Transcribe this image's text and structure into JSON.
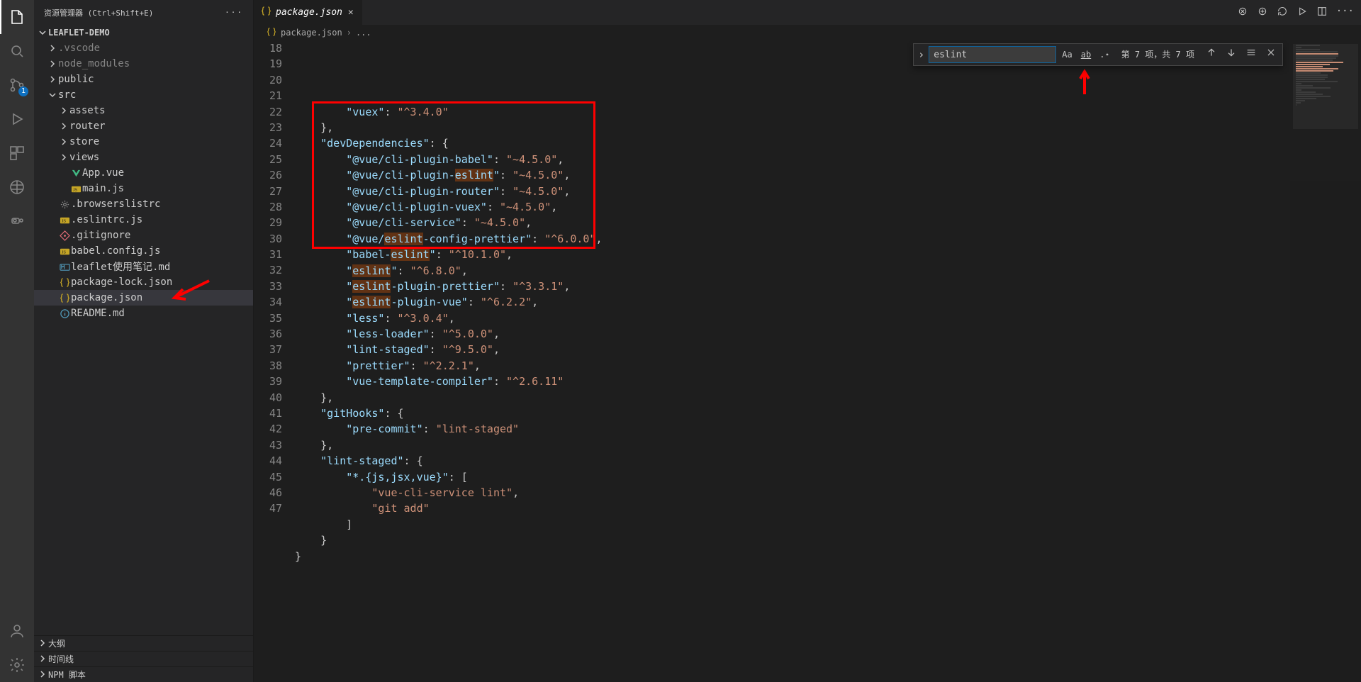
{
  "sidebar": {
    "title": "资源管理器 (Ctrl+Shift+E)",
    "project": "LEAFLET-DEMO",
    "outline": "大纲",
    "timeline": "时间线",
    "npm": "NPM 脚本",
    "sourceControlBadge": "1"
  },
  "tree": [
    {
      "depth": 1,
      "kind": "folder",
      "open": false,
      "label": ".vscode",
      "dim": true
    },
    {
      "depth": 1,
      "kind": "folder",
      "open": false,
      "label": "node_modules",
      "dim": true
    },
    {
      "depth": 1,
      "kind": "folder",
      "open": false,
      "label": "public"
    },
    {
      "depth": 1,
      "kind": "folder",
      "open": true,
      "label": "src"
    },
    {
      "depth": 2,
      "kind": "folder",
      "open": false,
      "label": "assets"
    },
    {
      "depth": 2,
      "kind": "folder",
      "open": false,
      "label": "router"
    },
    {
      "depth": 2,
      "kind": "folder",
      "open": false,
      "label": "store"
    },
    {
      "depth": 2,
      "kind": "folder",
      "open": false,
      "label": "views"
    },
    {
      "depth": 2,
      "kind": "file",
      "icon": "vue",
      "label": "App.vue"
    },
    {
      "depth": 2,
      "kind": "file",
      "icon": "js",
      "label": "main.js"
    },
    {
      "depth": 1,
      "kind": "file",
      "icon": "gear",
      "label": ".browserslistrc"
    },
    {
      "depth": 1,
      "kind": "file",
      "icon": "js",
      "label": ".eslintrc.js"
    },
    {
      "depth": 1,
      "kind": "file",
      "icon": "git",
      "label": ".gitignore"
    },
    {
      "depth": 1,
      "kind": "file",
      "icon": "js",
      "label": "babel.config.js"
    },
    {
      "depth": 1,
      "kind": "file",
      "icon": "md",
      "label": "leaflet使用笔记.md"
    },
    {
      "depth": 1,
      "kind": "file",
      "icon": "json",
      "label": "package-lock.json"
    },
    {
      "depth": 1,
      "kind": "file",
      "icon": "json",
      "label": "package.json",
      "selected": true
    },
    {
      "depth": 1,
      "kind": "file",
      "icon": "info",
      "label": "README.md"
    }
  ],
  "tab": {
    "label": "package.json"
  },
  "crumbs": {
    "file": "package.json",
    "tail": "..."
  },
  "find": {
    "value": "eslint",
    "count": "第 7 项，共 7 项"
  },
  "code": {
    "startLine": 18,
    "highlightWord": "eslint",
    "lines": [
      [
        [
          "        ",
          ""
        ],
        [
          "\"vuex\"",
          "k"
        ],
        [
          ": ",
          ""
        ],
        [
          "\"^3.4.0\"",
          "s"
        ]
      ],
      [
        [
          "    },",
          ""
        ]
      ],
      [
        [
          "    ",
          ""
        ],
        [
          "\"devDependencies\"",
          "k"
        ],
        [
          ": {",
          ""
        ]
      ],
      [
        [
          "        ",
          ""
        ],
        [
          "\"@vue/cli-plugin-babel\"",
          "k"
        ],
        [
          ": ",
          ""
        ],
        [
          "\"~4.5.0\"",
          "s"
        ],
        [
          ",",
          ""
        ]
      ],
      [
        [
          "        ",
          ""
        ],
        [
          "\"@vue/cli-plugin-eslint\"",
          "k"
        ],
        [
          ": ",
          ""
        ],
        [
          "\"~4.5.0\"",
          "s"
        ],
        [
          ",",
          ""
        ]
      ],
      [
        [
          "        ",
          ""
        ],
        [
          "\"@vue/cli-plugin-router\"",
          "k"
        ],
        [
          ": ",
          ""
        ],
        [
          "\"~4.5.0\"",
          "s"
        ],
        [
          ",",
          ""
        ]
      ],
      [
        [
          "        ",
          ""
        ],
        [
          "\"@vue/cli-plugin-vuex\"",
          "k"
        ],
        [
          ": ",
          ""
        ],
        [
          "\"~4.5.0\"",
          "s"
        ],
        [
          ",",
          ""
        ]
      ],
      [
        [
          "        ",
          ""
        ],
        [
          "\"@vue/cli-service\"",
          "k"
        ],
        [
          ": ",
          ""
        ],
        [
          "\"~4.5.0\"",
          "s"
        ],
        [
          ",",
          ""
        ]
      ],
      [
        [
          "        ",
          ""
        ],
        [
          "\"@vue/eslint-config-prettier\"",
          "k"
        ],
        [
          ": ",
          ""
        ],
        [
          "\"^6.0.0\"",
          "s"
        ],
        [
          ",",
          ""
        ]
      ],
      [
        [
          "        ",
          ""
        ],
        [
          "\"babel-eslint\"",
          "k"
        ],
        [
          ": ",
          ""
        ],
        [
          "\"^10.1.0\"",
          "s"
        ],
        [
          ",",
          ""
        ]
      ],
      [
        [
          "        ",
          ""
        ],
        [
          "\"eslint\"",
          "k"
        ],
        [
          ": ",
          ""
        ],
        [
          "\"^6.8.0\"",
          "s"
        ],
        [
          ",",
          ""
        ]
      ],
      [
        [
          "        ",
          ""
        ],
        [
          "\"eslint-plugin-prettier\"",
          "k"
        ],
        [
          ": ",
          ""
        ],
        [
          "\"^3.3.1\"",
          "s"
        ],
        [
          ",",
          ""
        ]
      ],
      [
        [
          "        ",
          ""
        ],
        [
          "\"eslint-plugin-vue\"",
          "k"
        ],
        [
          ": ",
          ""
        ],
        [
          "\"^6.2.2\"",
          "s"
        ],
        [
          ",",
          ""
        ]
      ],
      [
        [
          "        ",
          ""
        ],
        [
          "\"less\"",
          "k"
        ],
        [
          ": ",
          ""
        ],
        [
          "\"^3.0.4\"",
          "s"
        ],
        [
          ",",
          ""
        ]
      ],
      [
        [
          "        ",
          ""
        ],
        [
          "\"less-loader\"",
          "k"
        ],
        [
          ": ",
          ""
        ],
        [
          "\"^5.0.0\"",
          "s"
        ],
        [
          ",",
          ""
        ]
      ],
      [
        [
          "        ",
          ""
        ],
        [
          "\"lint-staged\"",
          "k"
        ],
        [
          ": ",
          ""
        ],
        [
          "\"^9.5.0\"",
          "s"
        ],
        [
          ",",
          ""
        ]
      ],
      [
        [
          "        ",
          ""
        ],
        [
          "\"prettier\"",
          "k"
        ],
        [
          ": ",
          ""
        ],
        [
          "\"^2.2.1\"",
          "s"
        ],
        [
          ",",
          ""
        ]
      ],
      [
        [
          "        ",
          ""
        ],
        [
          "\"vue-template-compiler\"",
          "k"
        ],
        [
          ": ",
          ""
        ],
        [
          "\"^2.6.11\"",
          "s"
        ]
      ],
      [
        [
          "    },",
          ""
        ]
      ],
      [
        [
          "    ",
          ""
        ],
        [
          "\"gitHooks\"",
          "k"
        ],
        [
          ": {",
          ""
        ]
      ],
      [
        [
          "        ",
          ""
        ],
        [
          "\"pre-commit\"",
          "k"
        ],
        [
          ": ",
          ""
        ],
        [
          "\"lint-staged\"",
          "s"
        ]
      ],
      [
        [
          "    },",
          ""
        ]
      ],
      [
        [
          "    ",
          ""
        ],
        [
          "\"lint-staged\"",
          "k"
        ],
        [
          ": {",
          ""
        ]
      ],
      [
        [
          "        ",
          ""
        ],
        [
          "\"*.{js,jsx,vue}\"",
          "k"
        ],
        [
          ": [",
          ""
        ]
      ],
      [
        [
          "            ",
          ""
        ],
        [
          "\"vue-cli-service lint\"",
          "s"
        ],
        [
          ",",
          ""
        ]
      ],
      [
        [
          "            ",
          ""
        ],
        [
          "\"git add\"",
          "s"
        ]
      ],
      [
        [
          "        ]",
          ""
        ]
      ],
      [
        [
          "    }",
          ""
        ]
      ],
      [
        [
          "}",
          ""
        ]
      ],
      [
        [
          "",
          ""
        ]
      ]
    ]
  }
}
